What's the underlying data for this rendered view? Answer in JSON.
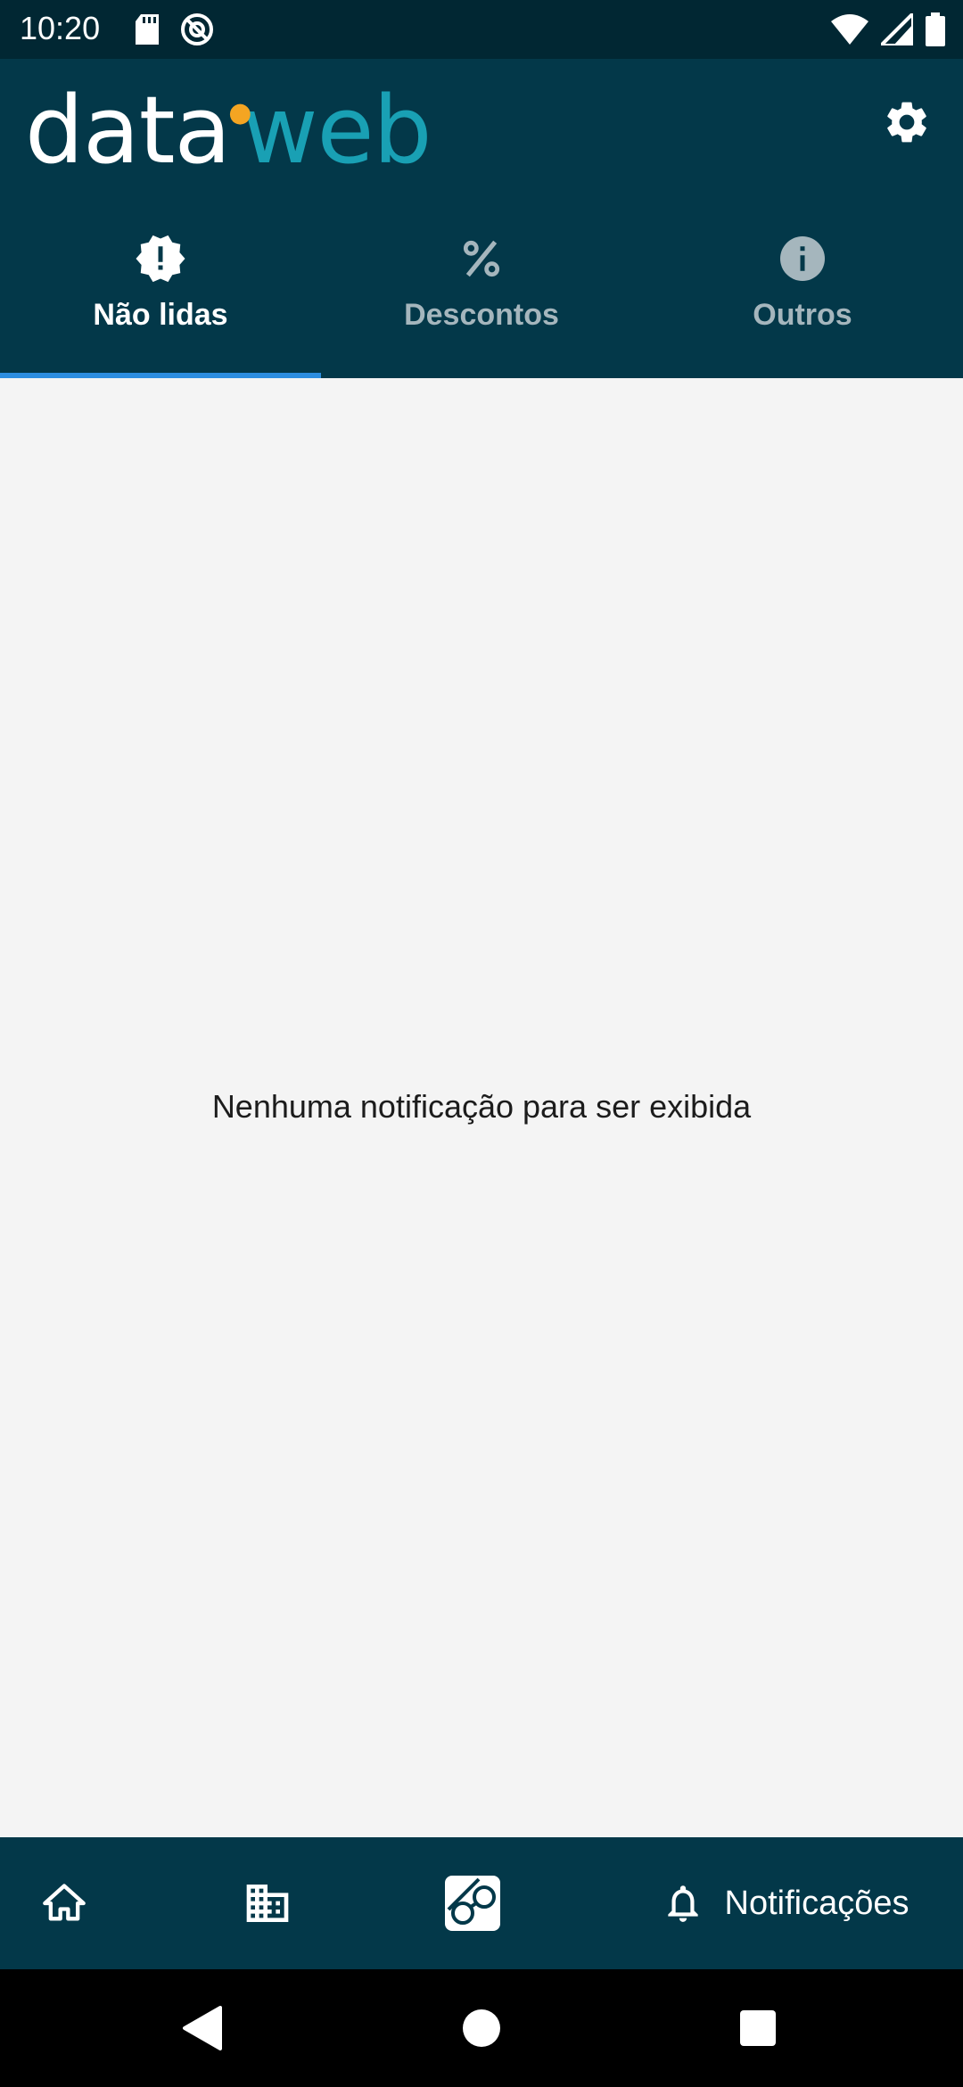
{
  "status_bar": {
    "time": "10:20",
    "left_icons": [
      "sd-card-icon",
      "do-not-disturb-icon"
    ],
    "right_icons": [
      "wifi-icon",
      "signal-icon",
      "battery-icon"
    ]
  },
  "header": {
    "logo_part1": "data",
    "logo_part2": "web",
    "settings_icon": "gear-icon"
  },
  "tabs": [
    {
      "label": "Não lidas",
      "icon": "alert-badge-icon",
      "active": true
    },
    {
      "label": "Descontos",
      "icon": "percent-icon",
      "active": false
    },
    {
      "label": "Outros",
      "icon": "info-icon",
      "active": false
    }
  ],
  "content": {
    "empty_message": "Nenhuma notificação para ser exibida"
  },
  "bottom_nav": {
    "items": [
      {
        "icon": "home-icon"
      },
      {
        "icon": "building-icon"
      },
      {
        "icon": "glasses-icon"
      },
      {
        "icon": "bell-icon",
        "label": "Notificações"
      }
    ]
  },
  "system_nav": [
    "back-icon",
    "home-circle-icon",
    "recents-icon"
  ],
  "colors": {
    "header_bg": "#033849",
    "status_bg": "#012733",
    "accent_blue": "#2d8ee0",
    "logo_teal": "#19a0b4",
    "logo_orange": "#f4a522"
  }
}
